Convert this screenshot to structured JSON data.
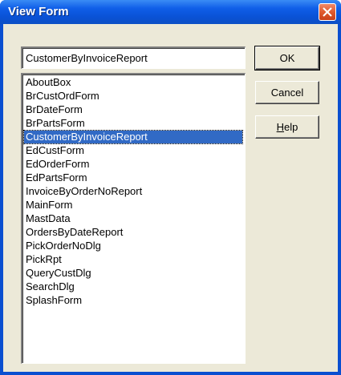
{
  "window": {
    "title": "View Form",
    "close_glyph": "close-icon"
  },
  "form_input": {
    "value": "CustomerByInvoiceReport"
  },
  "form_list": {
    "selected_index": 4,
    "items": [
      "AboutBox",
      "BrCustOrdForm",
      "BrDateForm",
      "BrPartsForm",
      "CustomerByInvoiceReport",
      "EdCustForm",
      "EdOrderForm",
      "EdPartsForm",
      "InvoiceByOrderNoReport",
      "MainForm",
      "MastData",
      "OrdersByDateReport",
      "PickOrderNoDlg",
      "PickRpt",
      "QueryCustDlg",
      "SearchDlg",
      "SplashForm"
    ]
  },
  "buttons": {
    "ok_label": "OK",
    "cancel_label": "Cancel",
    "help_label_underlined": "H",
    "help_label_rest": "elp"
  },
  "colors": {
    "title_bar": "#0a52d6",
    "dialog_face": "#ece9d8",
    "selection": "#316ac5"
  }
}
